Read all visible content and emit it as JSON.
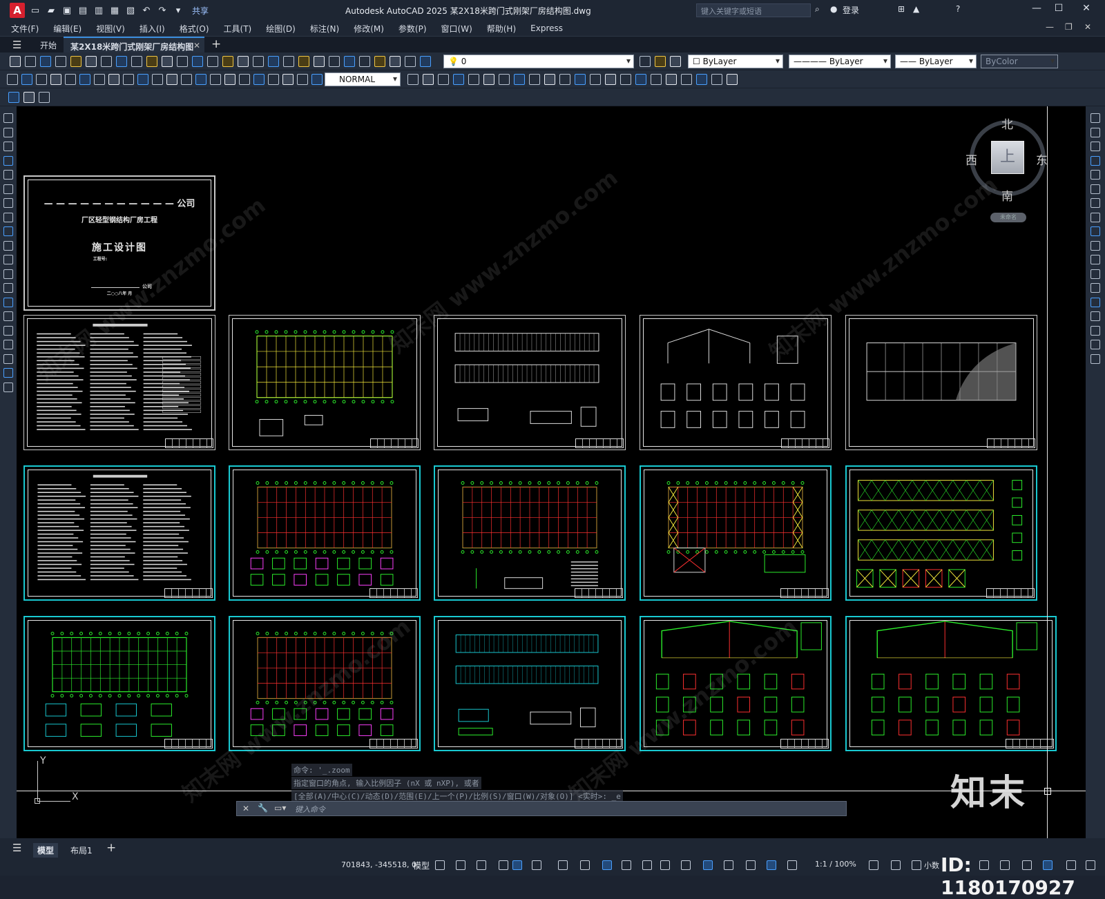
{
  "app": {
    "logo_letter": "A",
    "title": "Autodesk AutoCAD 2025    某2X18米跨门式刚架厂房结构图.dwg",
    "share_label": "共享",
    "search_placeholder": "键入关键字或短语",
    "login_label": "登录"
  },
  "menu": [
    "文件(F)",
    "编辑(E)",
    "视图(V)",
    "插入(I)",
    "格式(O)",
    "工具(T)",
    "绘图(D)",
    "标注(N)",
    "修改(M)",
    "参数(P)",
    "窗口(W)",
    "帮助(H)",
    "Express"
  ],
  "tabs": {
    "start": "开始",
    "document": "某2X18米跨门式刚架厂房结构图*"
  },
  "toolbar": {
    "layer_value": "0",
    "color_value": "ByLayer",
    "linetype_value": "ByLayer",
    "lineweight_value": "ByLayer",
    "plotstyle_value": "ByColor",
    "dimstyle_value": "NORMAL"
  },
  "viewcube": {
    "north": "北",
    "south": "南",
    "east": "东",
    "west": "西",
    "face": "上",
    "ucs_label": "未命名"
  },
  "cover_sheet": {
    "company": "— — — — — — — — — — — 公司",
    "project": "厂区轻型钢结构厂房工程",
    "title": "施工设计图",
    "subtitle": "工程号:",
    "sign": "公司",
    "date": "二○○八年    月"
  },
  "command": {
    "line1": "命令: '_.zoom",
    "line2": "指定窗口的角点, 输入比例因子 (nX 或 nXP), 或者",
    "line3": "[全部(A)/中心(C)/动态(D)/范围(E)/上一个(P)/比例(S)/窗口(W)/对象(O)] <实时>: _e",
    "placeholder": "键入命令"
  },
  "axes": {
    "y": "Y",
    "x": "X"
  },
  "layouts": {
    "model": "模型",
    "layout1": "布局1"
  },
  "status": {
    "coords": "701843, -345518, 0",
    "mode": "模型",
    "scale": "1:1 / 100%",
    "units": "小数"
  },
  "watermarks": {
    "brand": "知末",
    "id": "ID: 1180170927",
    "diagonal": "知末网 www.znzmo.com"
  },
  "colors": {
    "accent": "#3a8dde",
    "sheet_border_cyan": "#19c9d1",
    "drawing_green": "#2cf02c",
    "drawing_yellow": "#f2e63a",
    "drawing_red": "#ff3030",
    "drawing_magenta": "#ff40ff",
    "canvas": "#000000"
  }
}
